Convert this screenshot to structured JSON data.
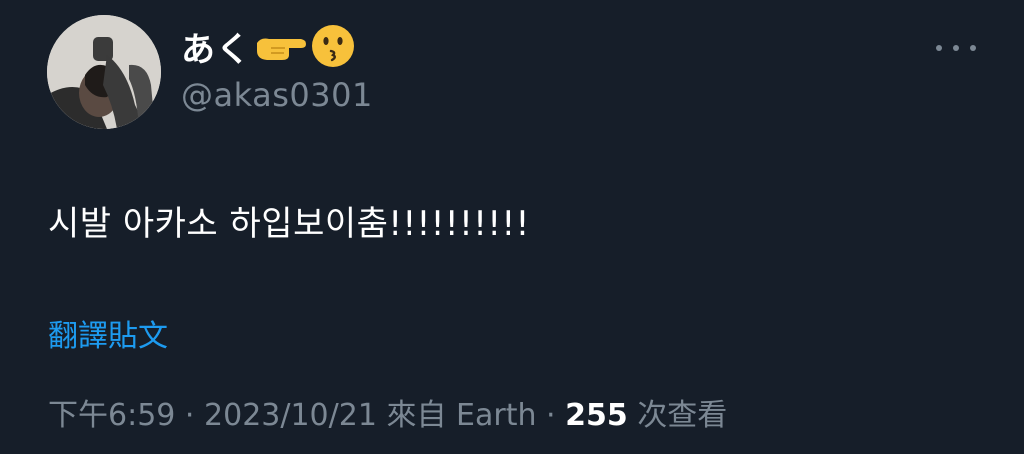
{
  "user": {
    "display_name": "あく",
    "display_emojis": [
      "backhand-index-pointing-right-emoji",
      "kissing-face-emoji"
    ],
    "handle": "@akas0301"
  },
  "tweet": {
    "text": "시발 아카소 하입보이춤!!!!!!!!!!",
    "translate_label": "翻譯貼文",
    "time": "下午6:59",
    "date": "2023/10/21",
    "source": "來自 Earth",
    "separator": "·",
    "views_count": "255",
    "views_label": "次查看"
  },
  "colors": {
    "background": "#161e29",
    "primary_text": "#ffffff",
    "secondary_text": "#7c8894",
    "link": "#1d9bf0"
  }
}
